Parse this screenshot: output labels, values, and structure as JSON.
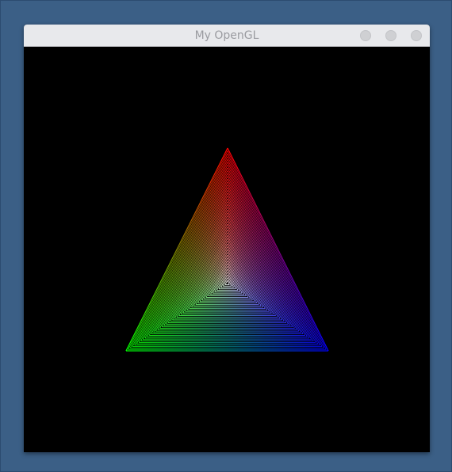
{
  "window": {
    "title": "My OpenGL"
  },
  "scene": {
    "background": "#000000",
    "vertex_colors": {
      "top": "#ff0000",
      "bottom_left": "#00ff00",
      "bottom_right": "#0000ff"
    },
    "wireframe": true
  },
  "icons": {
    "minimize": "minimize-icon",
    "maximize": "maximize-icon",
    "close": "close-icon"
  }
}
